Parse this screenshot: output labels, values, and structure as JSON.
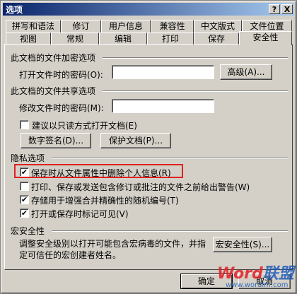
{
  "window": {
    "title": "选项",
    "help_glyph": "?",
    "close_glyph": "X"
  },
  "tabs_row1": [
    "拼写和语法",
    "修订",
    "用户信息",
    "兼容性",
    "中文版式",
    "文件位置"
  ],
  "tabs_row2": [
    "视图",
    "常规",
    "编辑",
    "打印",
    "保存",
    "安全性"
  ],
  "encrypt": {
    "heading": "此文档的文件加密选项",
    "open_password_label": "打开文件时的密码(O):",
    "open_password_value": "",
    "advanced_button": "高级(A)..."
  },
  "share": {
    "heading": "此文档的文件共享选项",
    "modify_password_label": "修改文件时的密码(M):",
    "modify_password_value": "",
    "readonly_label": "建议以只读方式打开文档(E)",
    "readonly_checked": "",
    "digital_signature_button": "数字签名(D)...",
    "protect_document_button": "保护文档(P)..."
  },
  "privacy": {
    "heading": "隐私选项",
    "items": [
      {
        "label": "保存时从文件属性中删除个人信息(R)",
        "check": "✔"
      },
      {
        "label": "打印、保存或发送包含修订或批注的文件之前给出警告(W)",
        "check": ""
      },
      {
        "label": "存储用于增强合并精确性的随机编号(T)",
        "check": "✔"
      },
      {
        "label": "打开或保存时标记可见(V)",
        "check": "✔"
      }
    ]
  },
  "macro": {
    "heading": "宏安全性",
    "description_line1": "调整安全级别以打开可能包含宏病毒的文件，并指",
    "description_line2": "定可信任的宏创建者姓名。",
    "macro_security_button": "宏安全性(S)..."
  },
  "footer": {
    "ok_button": "确定",
    "cancel_button": "取消"
  },
  "watermark": {
    "brand_word": "Word",
    "brand_cn": "联盟",
    "url": "www.wordlm.com"
  }
}
